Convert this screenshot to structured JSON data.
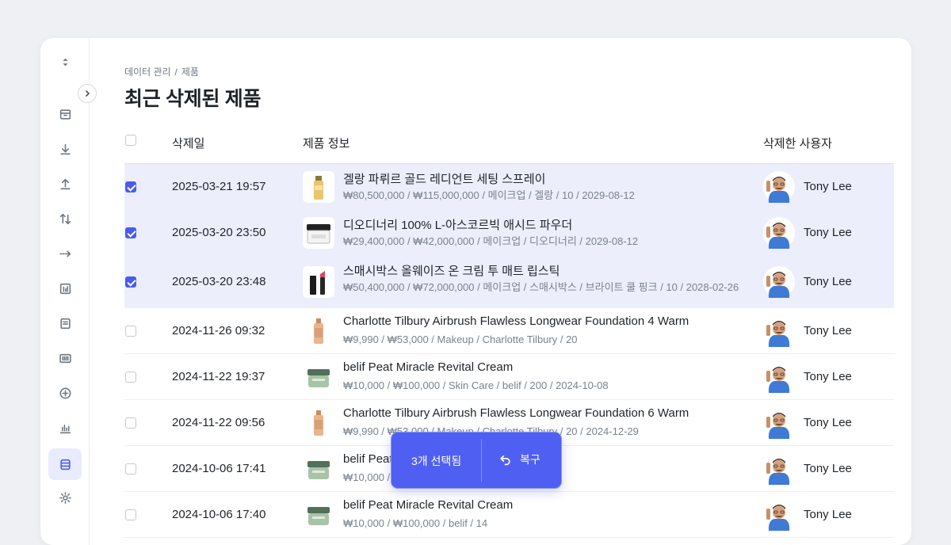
{
  "breadcrumb": {
    "parent": "데이터 관리",
    "separator": "/",
    "current": "제품"
  },
  "page_title": "최근 삭제된 제품",
  "table": {
    "headers": {
      "date": "삭제일",
      "product": "제품 정보",
      "user": "삭제한 사용자"
    },
    "rows": [
      {
        "selected": true,
        "date": "2025-03-21 19:57",
        "name": "겔랑 파뤼르 골드 레디언트 세팅 스프레이",
        "meta": "₩80,500,000 / ₩115,000,000 / 메이크업 / 겔랑 / 10 / 2029-08-12",
        "user": "Tony Lee",
        "thumb": "spray-bottle"
      },
      {
        "selected": true,
        "date": "2025-03-20 23:50",
        "name": "디오디너리 100% L-아스코르빅 애시드 파우더",
        "meta": "₩29,400,000 / ₩42,000,000 / 메이크업 / 디오디너리 / 2029-08-12",
        "user": "Tony Lee",
        "thumb": "powder-jar"
      },
      {
        "selected": true,
        "date": "2025-03-20 23:48",
        "name": "스매시박스 올웨이즈 온 크림 투 매트 립스틱",
        "meta": "₩50,400,000 / ₩72,000,000 / 메이크업 / 스매시박스 / 브라이트 쿨 핑크 / 10 / 2028-02-26",
        "user": "Tony Lee",
        "thumb": "lipstick"
      },
      {
        "selected": false,
        "date": "2024-11-26 09:32",
        "name": "Charlotte Tilbury Airbrush Flawless Longwear Foundation 4 Warm",
        "meta": "₩9,990 / ₩53,000 / Makeup / Charlotte Tilbury / 20",
        "user": "Tony Lee",
        "thumb": "foundation"
      },
      {
        "selected": false,
        "date": "2024-11-22 19:37",
        "name": "belif Peat Miracle Revital Cream",
        "meta": "₩10,000 / ₩100,000 / Skin Care / belif / 200 / 2024-10-08",
        "user": "Tony Lee",
        "thumb": "cream-jar"
      },
      {
        "selected": false,
        "date": "2024-11-22 09:56",
        "name": "Charlotte Tilbury Airbrush Flawless Longwear Foundation 6 Warm",
        "meta": "₩9,990 / ₩53,000 / Makeup / Charlotte Tilbury / 20 / 2024-12-29",
        "user": "Tony Lee",
        "thumb": "foundation"
      },
      {
        "selected": false,
        "date": "2024-10-06 17:41",
        "name": "belif Peat Miracle Revital Cream",
        "meta": "₩10,000 / ₩100,000 / Skin Care / belif / 200",
        "user": "Tony Lee",
        "thumb": "cream-jar"
      },
      {
        "selected": false,
        "date": "2024-10-06 17:40",
        "name": "belif Peat Miracle Revital Cream",
        "meta": "₩10,000 / ₩100,000 / belif / 14",
        "user": "Tony Lee",
        "thumb": "cream-jar"
      }
    ]
  },
  "floating_bar": {
    "selected_count_label": "3개 선택됨",
    "restore_label": "복구"
  },
  "sidebar": {
    "icons": [
      "sort-icon",
      "box-icon",
      "download-icon",
      "upload-icon",
      "transfer-icon",
      "arrow-right-icon",
      "chart-box-icon",
      "document-icon",
      "barcode-icon",
      "plus-circle-icon",
      "bar-chart-icon",
      "database-icon",
      "settings-icon"
    ],
    "active": "database-icon"
  },
  "colors": {
    "accent": "#4a5bf0",
    "selected_row": "#eceefc",
    "floating_bar": "#4f5ff2"
  }
}
